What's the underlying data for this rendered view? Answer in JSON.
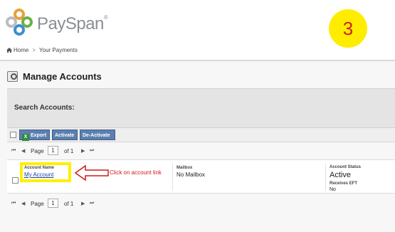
{
  "brand": {
    "name": "PaySpan",
    "reg_mark": "®"
  },
  "step_badge": "3",
  "breadcrumb": {
    "home": "Home",
    "separator": ">",
    "current": "Your Payments"
  },
  "page": {
    "title": "Manage Accounts"
  },
  "search": {
    "label": "Search Accounts:"
  },
  "toolbar": {
    "export_label": "Export",
    "export_icon": "X",
    "activate_label": "Activate",
    "deactivate_label": "De-Activate"
  },
  "pager": {
    "first": "⏮",
    "prev": "◀",
    "page_label": "Page",
    "current_page": "1",
    "of_label": "of 1",
    "next": "▶",
    "last": "⏭"
  },
  "table": {
    "account_name_header": "Account Name",
    "mailbox_header": "Mailbox",
    "status_header": "Account Status",
    "eft_header": "Receives EFT",
    "row": {
      "account_name": "My Account",
      "mailbox": "No Mailbox",
      "status": "Active",
      "receives_eft": "No"
    }
  },
  "annotation": {
    "note": "Click on account link",
    "color": "#d11a1a"
  },
  "colors": {
    "button_bg": "#5b7fae",
    "badge_bg": "#ffed00",
    "badge_text": "#d21f1f",
    "highlight": "#ffef00",
    "link": "#1a3ea6"
  }
}
